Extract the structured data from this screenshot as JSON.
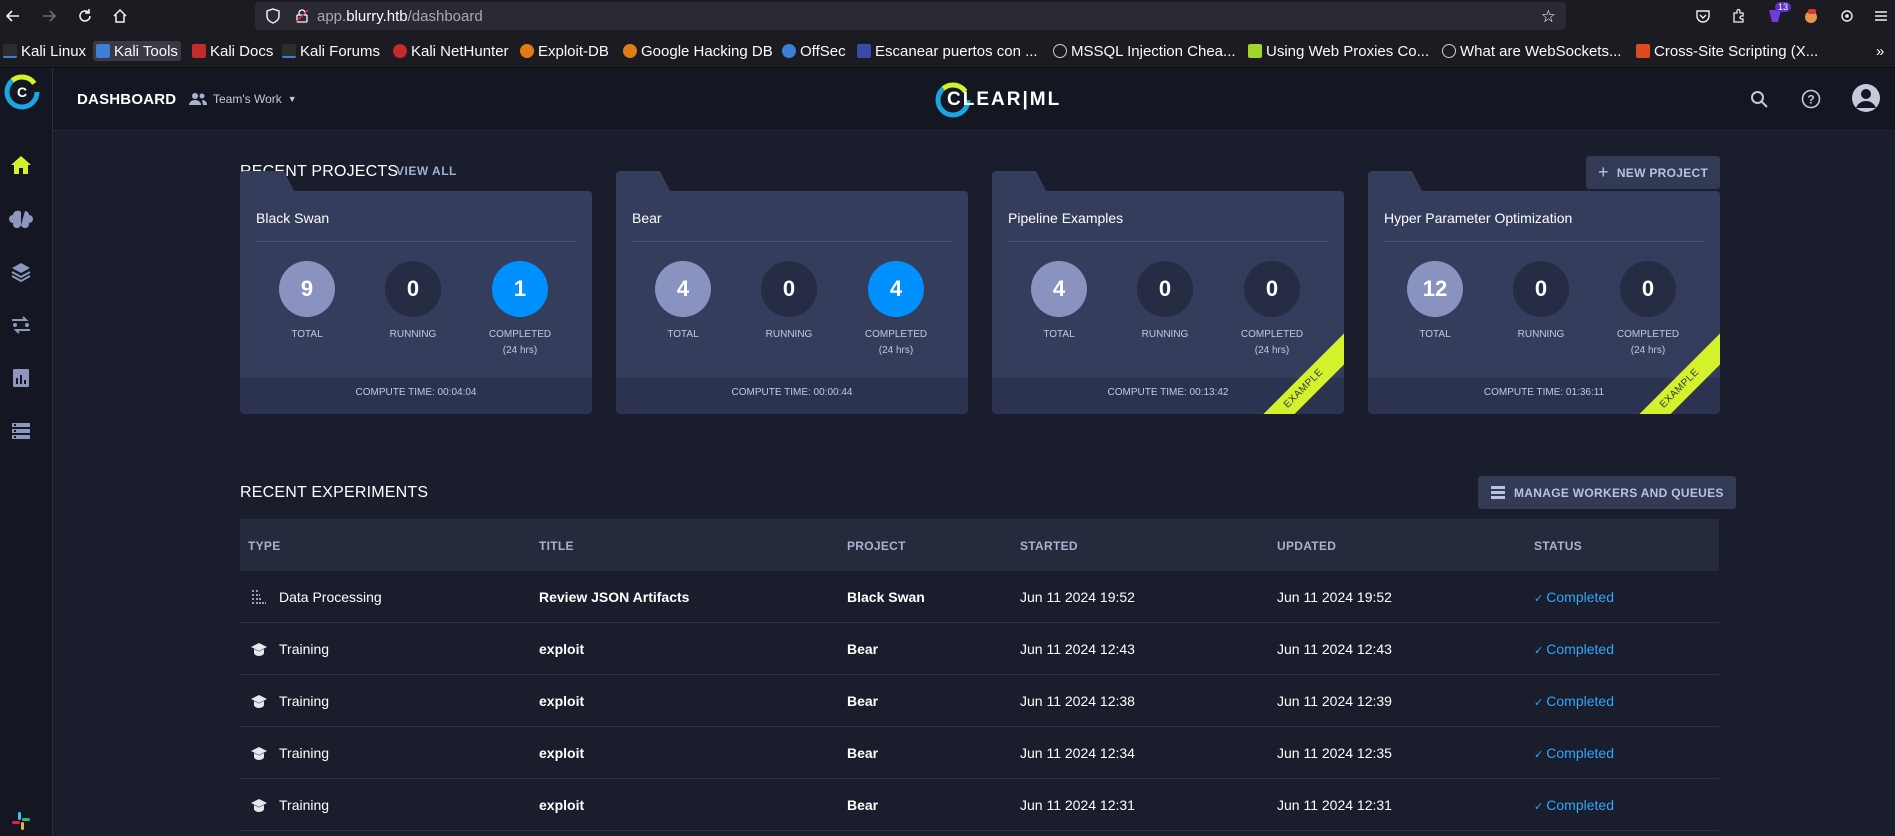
{
  "browser": {
    "url_host": "app.blurry.htb",
    "url_path": "/dashboard",
    "url_prefix": "app.",
    "url_domain": "blurry.htb",
    "badge_count": "13",
    "bookmarks": [
      {
        "label": "Kali Linux",
        "color": "#3d7fd6"
      },
      {
        "label": "Kali Tools",
        "color": "#3d7fd6"
      },
      {
        "label": "Kali Docs",
        "color": "#c42b2b"
      },
      {
        "label": "Kali Forums",
        "color": "#3d7fd6"
      },
      {
        "label": "Kali NetHunter",
        "color": "#c42b2b"
      },
      {
        "label": "Exploit-DB",
        "color": "#e07b16"
      },
      {
        "label": "Google Hacking DB",
        "color": "#e07b16"
      },
      {
        "label": "OffSec",
        "color": "#3d7fd6"
      },
      {
        "label": "Escanear puertos con ...",
        "color": "#3a4aa8"
      },
      {
        "label": "MSSQL Injection Chea...",
        "color": "#cfcfcf"
      },
      {
        "label": "Using Web Proxies Co...",
        "color": "#9fd62b"
      },
      {
        "label": "What are WebSockets...",
        "color": "#cfcfcf"
      },
      {
        "label": "Cross-Site Scripting (X...",
        "color": "#e04a1f"
      }
    ]
  },
  "header": {
    "title": "DASHBOARD",
    "workspace": "Team's Work",
    "brand": "CLEAR|ML"
  },
  "projects": {
    "title": "RECENT PROJECTS",
    "view_all": "VIEW ALL",
    "new_project": "NEW PROJECT",
    "items": [
      {
        "name": "Black Swan",
        "total": "9",
        "running": "0",
        "completed": "1",
        "compute": "COMPUTE TIME: 00:04:04",
        "example": false,
        "completed_highlight": true
      },
      {
        "name": "Bear",
        "total": "4",
        "running": "0",
        "completed": "4",
        "compute": "COMPUTE TIME: 00:00:44",
        "example": false,
        "completed_highlight": true
      },
      {
        "name": "Pipeline Examples",
        "total": "4",
        "running": "0",
        "completed": "0",
        "compute": "COMPUTE TIME: 00:13:42",
        "example": true,
        "completed_highlight": false
      },
      {
        "name": "Hyper Parameter Optimization",
        "total": "12",
        "running": "0",
        "completed": "0",
        "compute": "COMPUTE TIME: 01:36:11",
        "example": true,
        "completed_highlight": false
      }
    ],
    "labels": {
      "total": "TOTAL",
      "running": "RUNNING",
      "completed": "COMPLETED",
      "period": "(24 hrs)",
      "example": "EXAMPLE"
    }
  },
  "experiments": {
    "title": "RECENT EXPERIMENTS",
    "manage": "MANAGE WORKERS AND QUEUES",
    "columns": [
      "TYPE",
      "TITLE",
      "PROJECT",
      "STARTED",
      "UPDATED",
      "STATUS"
    ],
    "rows": [
      {
        "type": "Data Processing",
        "icon": "data-processing-icon",
        "title": "Review JSON Artifacts",
        "project": "Black Swan",
        "started": "Jun 11 2024 19:52",
        "updated": "Jun 11 2024 19:52",
        "status": "Completed"
      },
      {
        "type": "Training",
        "icon": "training-icon",
        "title": "exploit",
        "project": "Bear",
        "started": "Jun 11 2024 12:43",
        "updated": "Jun 11 2024 12:43",
        "status": "Completed"
      },
      {
        "type": "Training",
        "icon": "training-icon",
        "title": "exploit",
        "project": "Bear",
        "started": "Jun 11 2024 12:38",
        "updated": "Jun 11 2024 12:39",
        "status": "Completed"
      },
      {
        "type": "Training",
        "icon": "training-icon",
        "title": "exploit",
        "project": "Bear",
        "started": "Jun 11 2024 12:34",
        "updated": "Jun 11 2024 12:35",
        "status": "Completed"
      },
      {
        "type": "Training",
        "icon": "training-icon",
        "title": "exploit",
        "project": "Bear",
        "started": "Jun 11 2024 12:31",
        "updated": "Jun 11 2024 12:31",
        "status": "Completed"
      }
    ]
  },
  "colors": {
    "accent": "#d4f22b",
    "completed_blue": "#0091ff",
    "status_blue": "#2ea7ff",
    "circle_total": "#8a93bf",
    "circle_zero": "#262c44"
  }
}
